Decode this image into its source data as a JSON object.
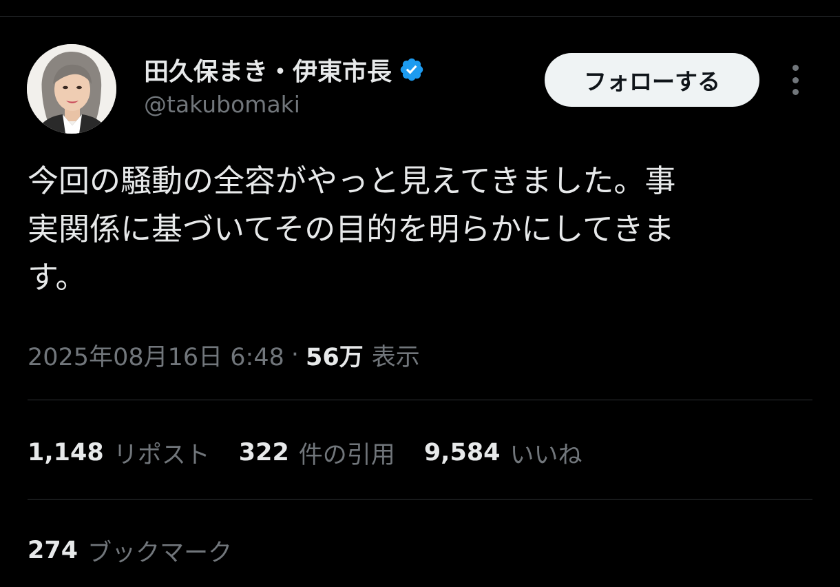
{
  "author": {
    "display_name": "田久保まき・伊東市長",
    "handle": "@takubomaki",
    "verified_icon": "verified-badge-icon",
    "verified_color": "#1d9bf0"
  },
  "actions": {
    "follow_label": "フォローする",
    "more_icon": "more-vertical-icon"
  },
  "tweet": {
    "lines": [
      "今回の騒動の全容がやっと見えてきました。事",
      "実関係に基づいてその目的を明らかにしてきま",
      "す。"
    ],
    "date": "2025年08月16日 6:48",
    "separator": "·",
    "views_count": "56万",
    "views_label": "表示"
  },
  "stats": {
    "retweets_count": "1,148",
    "retweets_label": "リポスト",
    "quotes_count": "322",
    "quotes_label": "件の引用",
    "likes_count": "9,584",
    "likes_label": "いいね",
    "bookmarks_count": "274",
    "bookmarks_label": "ブックマーク"
  },
  "colors": {
    "background": "#000000",
    "text_primary": "#e7e9ea",
    "text_secondary": "#71767b",
    "divider": "#2f3336",
    "follow_button_bg": "#eff3f4"
  }
}
